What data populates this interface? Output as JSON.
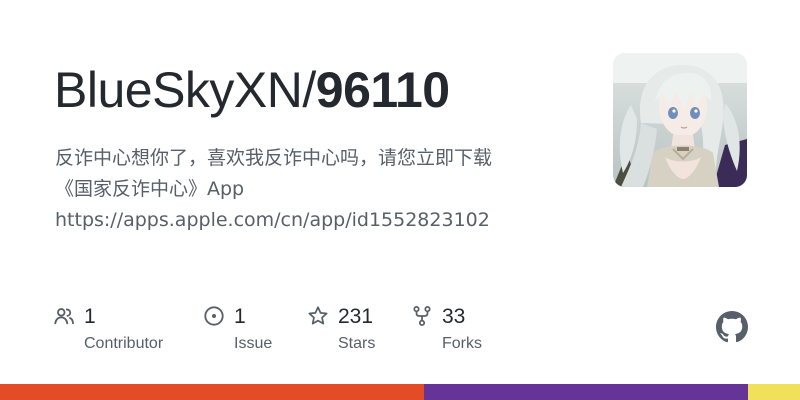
{
  "repo": {
    "owner": "BlueSkyXN/",
    "name": "96110",
    "description_lines": [
      "反诈中心想你了，喜欢我反诈中心吗，请您立即下载",
      "《国家反诈中心》App",
      "https://apps.apple.com/cn/app/id1552823102"
    ]
  },
  "stats": [
    {
      "value": "1",
      "label": "Contributor",
      "icon": "people-icon"
    },
    {
      "value": "1",
      "label": "Issue",
      "icon": "issue-icon"
    },
    {
      "value": "231",
      "label": "Stars",
      "icon": "star-icon"
    },
    {
      "value": "33",
      "label": "Forks",
      "icon": "fork-icon"
    }
  ],
  "language_bar": [
    {
      "color": "#e34c26",
      "percent": 53
    },
    {
      "color": "#663399",
      "percent": 40.5
    },
    {
      "color": "#f1e05a",
      "percent": 6.5
    }
  ],
  "colors": {
    "icon": "#57606a",
    "title": "#24292f"
  }
}
